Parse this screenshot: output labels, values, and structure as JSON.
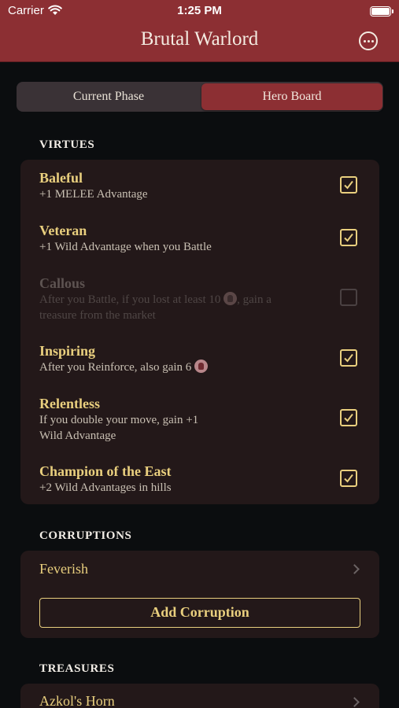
{
  "status": {
    "carrier": "Carrier",
    "time": "1:25 PM"
  },
  "nav": {
    "title": "Brutal Warlord",
    "more_icon": "ellipsis-circle-icon"
  },
  "tabs": [
    {
      "label": "Current Phase",
      "selected": false
    },
    {
      "label": "Hero Board",
      "selected": true
    }
  ],
  "virtues": {
    "header": "VIRTUES",
    "items": [
      {
        "name": "Baleful",
        "desc": "+1 MELEE Advantage",
        "checked": true,
        "enabled": true
      },
      {
        "name": "Veteran",
        "desc": "+1 Wild Advantage when you Battle",
        "checked": true,
        "enabled": true
      },
      {
        "name": "Callous",
        "desc_before": "After you Battle, if you lost at least 10",
        "desc_after": ", gain a",
        "desc_line2": "treasure from the market",
        "checked": false,
        "enabled": false
      },
      {
        "name": "Inspiring",
        "desc_before": "After you Reinforce, also gain 6",
        "checked": true,
        "enabled": true
      },
      {
        "name": "Relentless",
        "desc": "If you double your move, gain +1",
        "desc_line2": "Wild Advantage",
        "checked": true,
        "enabled": true
      },
      {
        "name": "Champion of the East",
        "desc": "+2 Wild Advantages in hills",
        "checked": true,
        "enabled": true
      }
    ]
  },
  "corruptions": {
    "header": "CORRUPTIONS",
    "items": [
      {
        "label": "Feverish"
      }
    ],
    "add_label": "Add Corruption"
  },
  "treasures": {
    "header": "TREASURES",
    "items": [
      {
        "label": "Azkol's Horn"
      }
    ]
  },
  "colors": {
    "accent": "#8c2f33",
    "gold": "#e9cf7e",
    "card": "#231819",
    "background": "#0b0d0f"
  }
}
